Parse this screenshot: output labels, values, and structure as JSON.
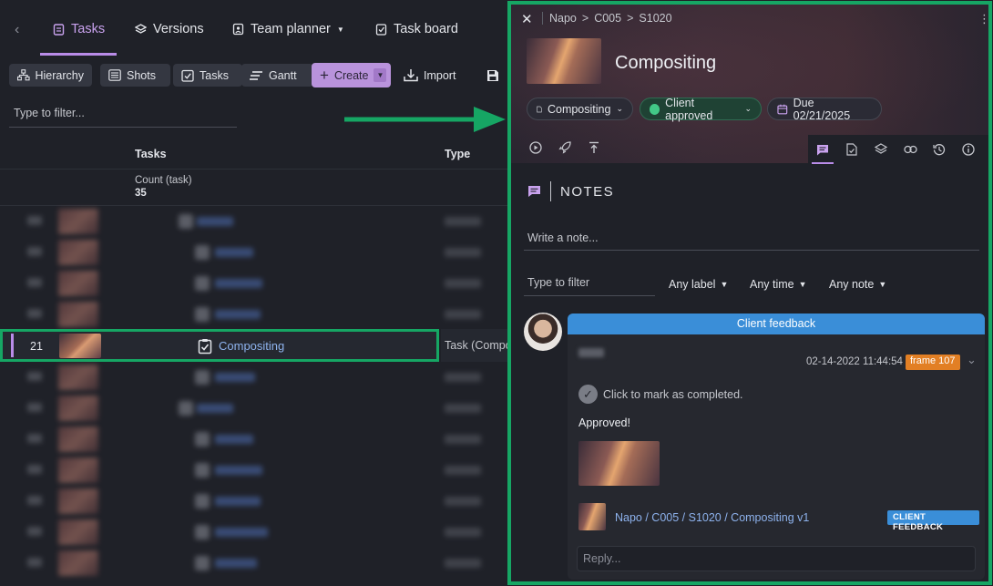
{
  "colors": {
    "accent": "#b98ce8",
    "highlight_border": "#16a664",
    "link": "#8eb3ee",
    "feedback_blue": "#3a8ed8",
    "frame_orange": "#e27f24",
    "approved_green": "#42c987"
  },
  "nav": {
    "tabs": [
      {
        "label": "Tasks",
        "icon": "clipboard-icon",
        "active": true
      },
      {
        "label": "Versions",
        "icon": "layers-icon"
      },
      {
        "label": "Team planner",
        "icon": "calendar-user-icon"
      },
      {
        "label": "Task board",
        "icon": "clipboard-check-icon"
      }
    ]
  },
  "toolbar": {
    "hierarchy": "Hierarchy",
    "shots": "Shots",
    "tasks": "Tasks",
    "gantt": "Gantt",
    "create": "Create",
    "import": "Import"
  },
  "table": {
    "filter_placeholder": "Type to filter...",
    "col_tasks": "Tasks",
    "col_type": "Type",
    "count_label": "Count (task)",
    "count_value": "35",
    "selected_row": {
      "number": "21",
      "name": "Compositing",
      "type": "Task (Compo"
    }
  },
  "panel": {
    "breadcrumbs": [
      "Napo",
      ">",
      "C005",
      ">",
      "S1020"
    ],
    "title": "Compositing",
    "chips": {
      "task": "Compositing",
      "status": "Client approved",
      "due": "Due 02/21/2025"
    },
    "notes_title": "NOTES",
    "write_note_placeholder": "Write a note...",
    "filter_placeholder": "Type to filter",
    "dropdowns": [
      "Any label",
      "Any time",
      "Any note"
    ],
    "note": {
      "banner": "Client feedback",
      "date": "02-14-2022 11:44:54",
      "frame": "frame 107",
      "mark_completed": "Click to mark as completed.",
      "text": "Approved!",
      "link": "Napo / C005 / S1020 / Compositing v1",
      "link_badge": "CLIENT FEEDBACK",
      "reply_placeholder": "Reply..."
    }
  }
}
